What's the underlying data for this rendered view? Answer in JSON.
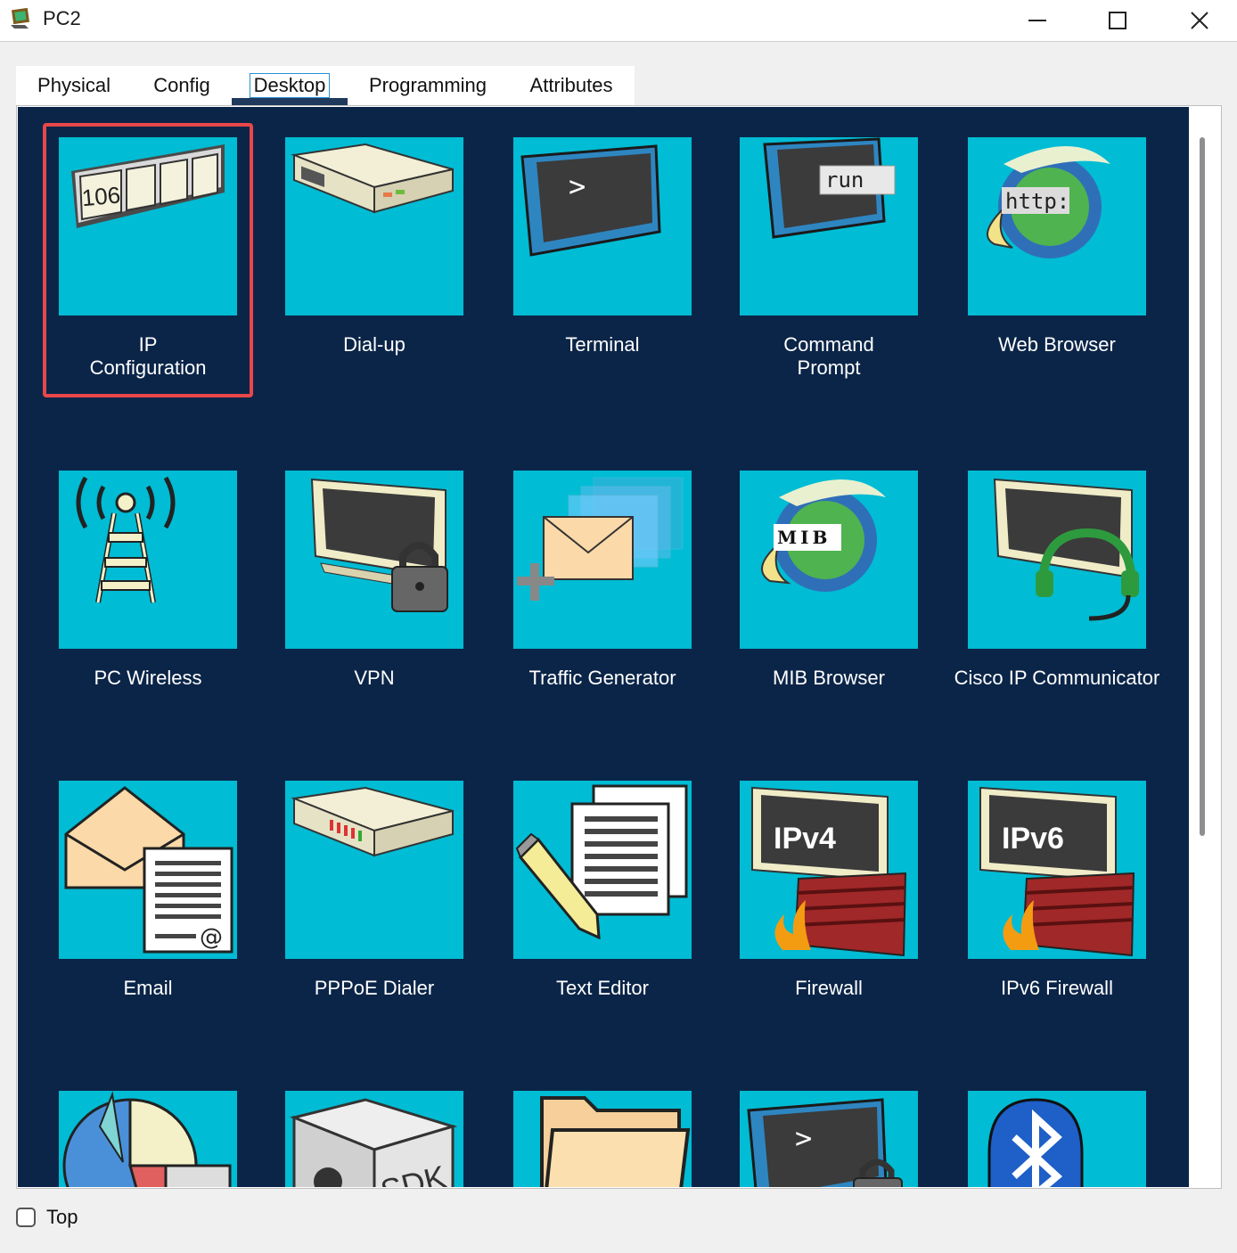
{
  "window": {
    "title": "PC2",
    "icons": {
      "app": "packet-tracer-pc-icon",
      "minimize": "minimize-icon",
      "maximize": "maximize-icon",
      "close": "close-icon"
    }
  },
  "tabs": [
    {
      "label": "Physical",
      "active": false
    },
    {
      "label": "Config",
      "active": false
    },
    {
      "label": "Desktop",
      "active": true
    },
    {
      "label": "Programming",
      "active": false
    },
    {
      "label": "Attributes",
      "active": false
    }
  ],
  "apps": [
    {
      "label": "IP\nConfiguration",
      "icon": "ip-configuration-icon",
      "tile_text": "106",
      "highlighted": true
    },
    {
      "label": "Dial-up",
      "icon": "dial-up-modem-icon"
    },
    {
      "label": "Terminal",
      "icon": "terminal-icon",
      "tile_text": ">"
    },
    {
      "label": "Command\nPrompt",
      "icon": "command-prompt-icon",
      "tile_text": "run"
    },
    {
      "label": "Web Browser",
      "icon": "web-browser-icon",
      "tile_text": "http:"
    },
    {
      "label": "PC Wireless",
      "icon": "wireless-tower-icon"
    },
    {
      "label": "VPN",
      "icon": "vpn-monitor-lock-icon"
    },
    {
      "label": "Traffic Generator",
      "icon": "traffic-generator-icon"
    },
    {
      "label": "MIB Browser",
      "icon": "mib-browser-icon",
      "tile_text": "MIB"
    },
    {
      "label": "Cisco IP Communicator",
      "icon": "ip-communicator-headset-icon"
    },
    {
      "label": "Email",
      "icon": "email-icon",
      "tile_text": "@"
    },
    {
      "label": "PPPoE Dialer",
      "icon": "pppoe-dialer-icon"
    },
    {
      "label": "Text Editor",
      "icon": "text-editor-icon"
    },
    {
      "label": "Firewall",
      "icon": "ipv4-firewall-icon",
      "tile_text": "IPv4"
    },
    {
      "label": "IPv6 Firewall",
      "icon": "ipv6-firewall-icon",
      "tile_text": "IPv6"
    },
    {
      "label": "",
      "icon": "pie-chart-icon"
    },
    {
      "label": "",
      "icon": "sdk-box-icon",
      "tile_text": "SDK"
    },
    {
      "label": "",
      "icon": "folder-icon"
    },
    {
      "label": "",
      "icon": "terminal-lock-icon",
      "tile_text": ">"
    },
    {
      "label": "",
      "icon": "bluetooth-icon"
    }
  ],
  "footer": {
    "checkbox_label": "Top",
    "checked": false
  },
  "colors": {
    "desktop_bg": "#0b2548",
    "tile_bg": "#00bcd4",
    "highlight": "#e8474a",
    "active_tab_underline": "#1f3a5c"
  }
}
